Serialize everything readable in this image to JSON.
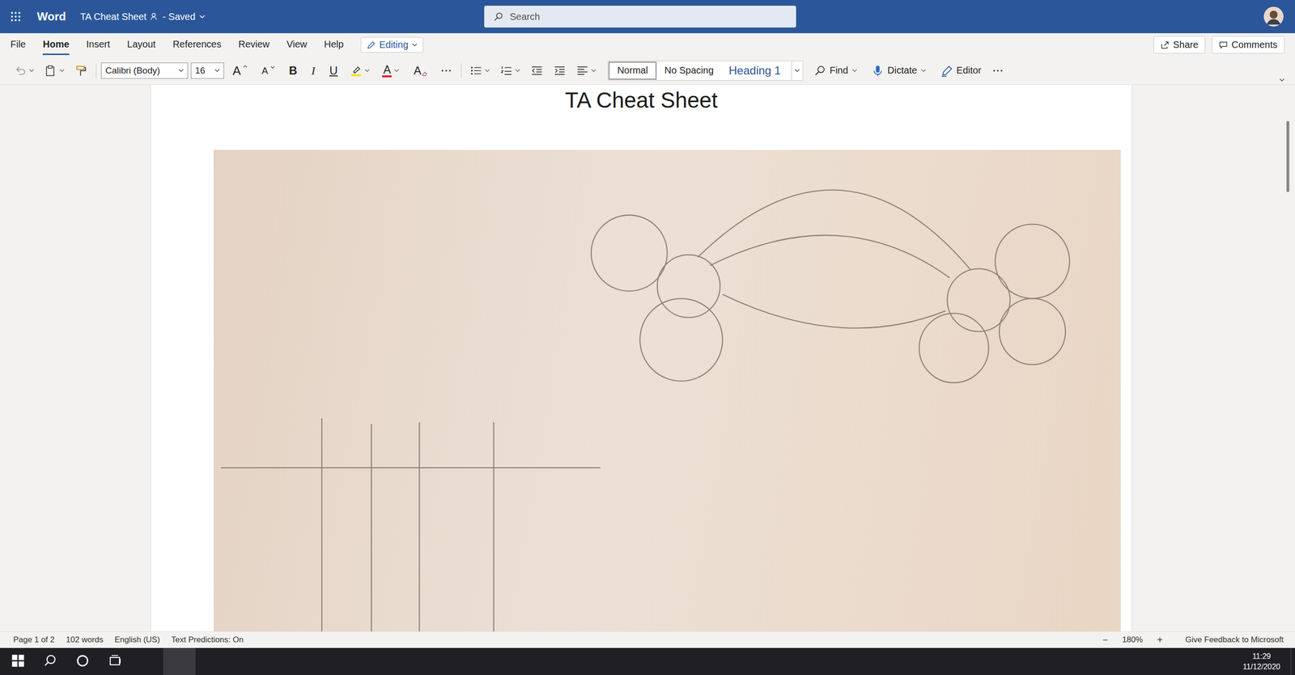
{
  "window": {
    "app": "Word",
    "title": "TA Cheat Sheet",
    "save_status": "- Saved"
  },
  "search": {
    "placeholder": "Search"
  },
  "menu_tabs": [
    {
      "label": "File",
      "selected": false
    },
    {
      "label": "Home",
      "selected": true
    },
    {
      "label": "Insert",
      "selected": false
    },
    {
      "label": "Layout",
      "selected": false
    },
    {
      "label": "References",
      "selected": false
    },
    {
      "label": "Review",
      "selected": false
    },
    {
      "label": "View",
      "selected": false
    },
    {
      "label": "Help",
      "selected": false
    }
  ],
  "mode_button": {
    "label": "Editing"
  },
  "header_buttons": [
    {
      "label": "Share",
      "kind": "share"
    },
    {
      "label": "Comments",
      "kind": "comments"
    }
  ],
  "toolbar": {
    "font": "Calibri (Body)",
    "size": "16",
    "text_buttons": [
      {
        "label": "A",
        "kind": "grow"
      },
      {
        "label": "A",
        "kind": "shrink"
      },
      {
        "label": "B",
        "kind": "bold"
      },
      {
        "label": "I",
        "kind": "italic"
      },
      {
        "label": "U",
        "kind": "underline"
      },
      {
        "label": "A",
        "kind": "font-color"
      },
      {
        "label": "A",
        "kind": "clear"
      }
    ],
    "styles": [
      {
        "label": "Normal",
        "selected": true
      },
      {
        "label": "No Spacing",
        "selected": false
      },
      {
        "label": "Heading 1",
        "selected": false
      }
    ],
    "tools": [
      {
        "label": "Find",
        "kind": "find"
      },
      {
        "label": "Dictate",
        "kind": "dictate"
      },
      {
        "label": "Editor",
        "kind": "editor"
      }
    ]
  },
  "document": {
    "heading": "TA Cheat Sheet"
  },
  "status_bar": {
    "items": [
      "Page 1 of 2",
      "102 words",
      "English (US)",
      "Text Predictions: On"
    ],
    "zoom_out": "−",
    "zoom": "180%",
    "zoom_in": "+",
    "feedback": "Give Feedback to Microsoft"
  },
  "taskbar": {
    "apps": [
      {
        "kind": "explorer",
        "selected": false
      },
      {
        "kind": "chrome",
        "selected": true
      },
      {
        "kind": "vscode",
        "selected": false
      },
      {
        "kind": "opera",
        "selected": false
      },
      {
        "kind": "teams",
        "selected": false
      },
      {
        "kind": "app",
        "selected": false
      }
    ],
    "time": "11:29",
    "date": "11/12/2020"
  }
}
